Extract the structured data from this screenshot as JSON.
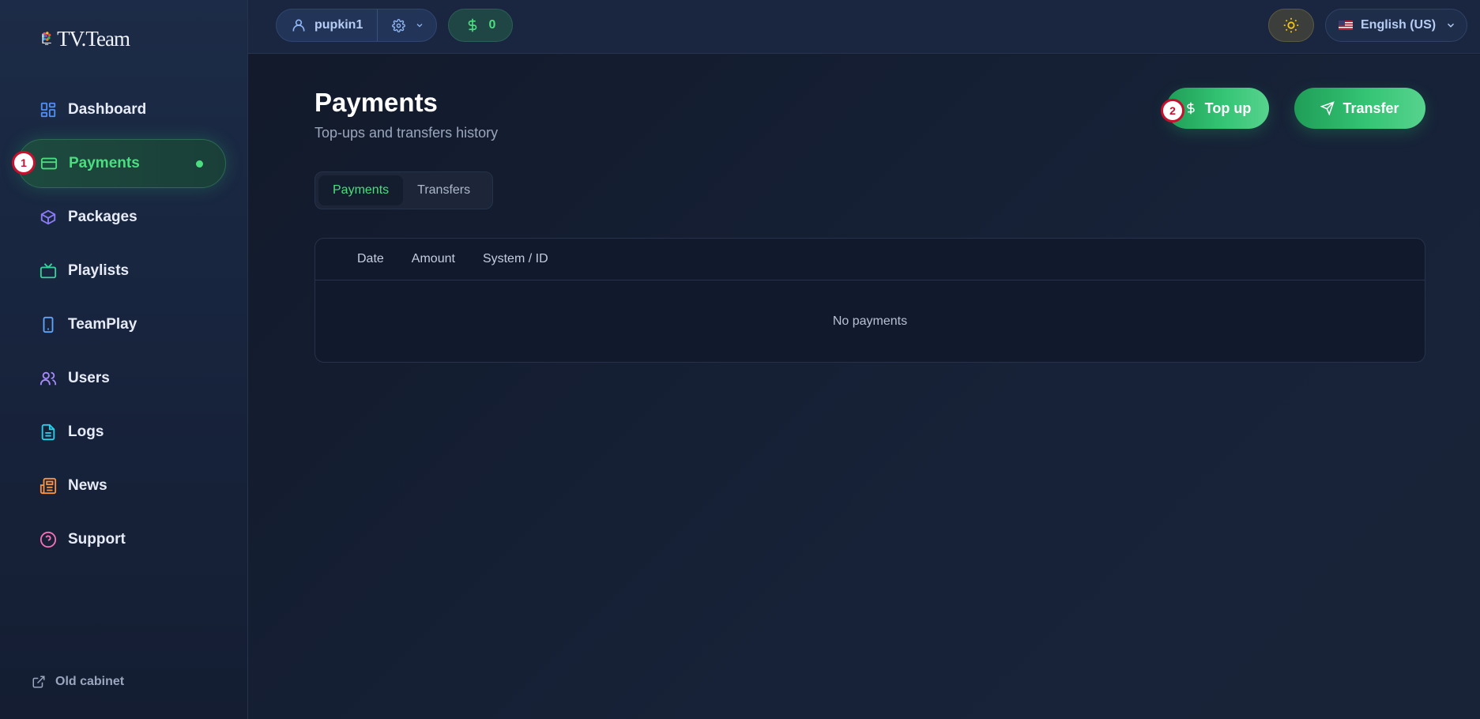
{
  "app": {
    "logo_text": "TV.Team"
  },
  "sidebar": {
    "items": [
      {
        "label": "Dashboard",
        "icon": "dashboard-icon",
        "color": "#4f8ff7"
      },
      {
        "label": "Payments",
        "icon": "credit-card-icon",
        "color": "#4ade80",
        "active": true
      },
      {
        "label": "Packages",
        "icon": "box-icon",
        "color": "#8b7cf6"
      },
      {
        "label": "Playlists",
        "icon": "tv-icon",
        "color": "#34d399"
      },
      {
        "label": "TeamPlay",
        "icon": "phone-icon",
        "color": "#60a5fa"
      },
      {
        "label": "Users",
        "icon": "users-icon",
        "color": "#a78bfa"
      },
      {
        "label": "Logs",
        "icon": "document-icon",
        "color": "#22d3ee"
      },
      {
        "label": "News",
        "icon": "newspaper-icon",
        "color": "#fb923c"
      },
      {
        "label": "Support",
        "icon": "help-circle-icon",
        "color": "#f472b6"
      }
    ],
    "old_cabinet": "Old cabinet"
  },
  "badges": {
    "first": "1",
    "second": "2"
  },
  "header": {
    "username": "pupkin1",
    "balance": "0",
    "language": "English (US)"
  },
  "main": {
    "title": "Payments",
    "subtitle": "Top-ups and transfers history",
    "topup_label": "Top up",
    "transfer_label": "Transfer",
    "tabs": [
      {
        "label": "Payments",
        "active": true
      },
      {
        "label": "Transfers",
        "active": false
      }
    ],
    "table": {
      "columns": [
        "Date",
        "Amount",
        "System / ID"
      ],
      "empty_text": "No payments"
    }
  },
  "colors": {
    "accent": "#4ade80",
    "primary_button": "#34c474",
    "badge_border": "#c8102e"
  }
}
